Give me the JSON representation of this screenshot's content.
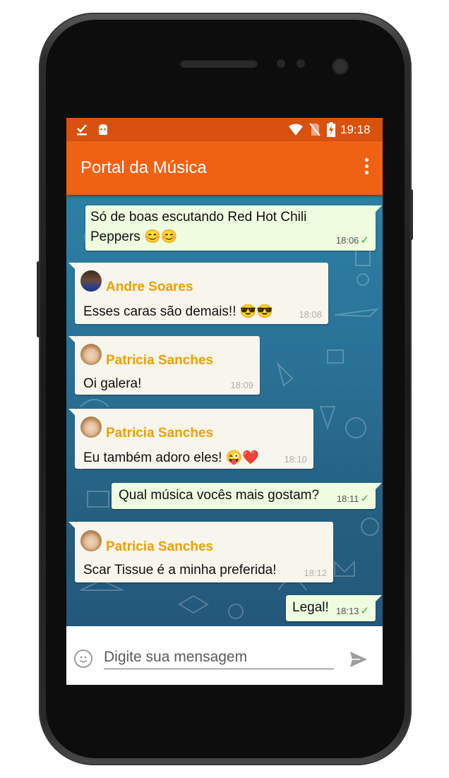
{
  "status_bar": {
    "time": "19:18"
  },
  "app_bar": {
    "title": "Portal da Música"
  },
  "messages": [
    {
      "direction": "out",
      "text": "Só de boas escutando Red Hot Chili",
      "text2": "Peppers 😊😊",
      "time": "18:06",
      "status": "sent"
    },
    {
      "direction": "in",
      "sender": "Andre Soares",
      "text": "Esses caras são demais!! 😎😎",
      "time": "18:08"
    },
    {
      "direction": "in",
      "sender": "Patricia Sanches",
      "text": "Oi galera!",
      "time": "18:09"
    },
    {
      "direction": "in",
      "sender": "Patricia Sanches",
      "text": "Eu também adoro eles! 😜❤️",
      "time": "18:10"
    },
    {
      "direction": "out",
      "text": "Qual música vocês mais gostam?",
      "time": "18:11",
      "status": "sent"
    },
    {
      "direction": "in",
      "sender": "Patricia Sanches",
      "text": "Scar Tissue é a minha preferida!",
      "time": "18:12"
    },
    {
      "direction": "out",
      "text": "Legal!",
      "time": "18:13",
      "status": "sent"
    }
  ],
  "composer": {
    "placeholder": "Digite sua mensagem",
    "value": ""
  },
  "icons": [
    "download-done-icon",
    "android-icon",
    "wifi-icon",
    "no-sim-icon",
    "battery-charging-icon",
    "overflow-menu-icon",
    "emoji-icon",
    "send-icon",
    "check-icon"
  ],
  "colors": {
    "status_bar": "#d9510e",
    "app_bar": "#ef6213",
    "sender_name": "#f0a000",
    "incoming_bubble": "#f7f5ec",
    "outgoing_bubble": "#eefce0",
    "check": "#3cb043"
  }
}
